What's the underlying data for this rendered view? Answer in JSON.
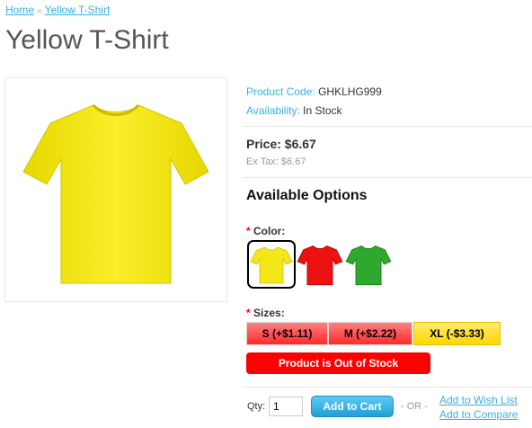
{
  "breadcrumb": {
    "home": "Home",
    "separator": "»",
    "current": "Yellow T-Shirt"
  },
  "product": {
    "title": "Yellow T-Shirt",
    "code_label": "Product Code:",
    "code": "GHKLHG999",
    "availability_label": "Availability:",
    "availability": "In Stock",
    "price": "Price: $6.67",
    "ex_tax": "Ex Tax: $6.67",
    "main_image_icon": "yellow-tshirt-image"
  },
  "options": {
    "title": "Available Options",
    "required_mark": "*",
    "color_label": "Color:",
    "colors": [
      {
        "name": "yellow",
        "hex": "#f3e619",
        "selected": true
      },
      {
        "name": "red",
        "hex": "#ee1111",
        "selected": false
      },
      {
        "name": "green",
        "hex": "#2ea92e",
        "selected": false
      }
    ],
    "sizes_label": "Sizes:",
    "sizes": [
      {
        "label": "S (+$1.11)",
        "style": "red"
      },
      {
        "label": "M (+$2.22)",
        "style": "red"
      },
      {
        "label": "XL (-$3.33)",
        "style": "yellow"
      }
    ],
    "out_of_stock": "Product is Out of Stock"
  },
  "purchase": {
    "qty_label": "Qty:",
    "qty_value": "1",
    "add_to_cart": "Add to Cart",
    "or": "- OR -",
    "wishlist": "Add to Wish List",
    "compare": "Add to Compare"
  },
  "colors": {
    "accent": "#38b0e3",
    "out_of_stock": "#ff0000",
    "title": "#555555"
  }
}
